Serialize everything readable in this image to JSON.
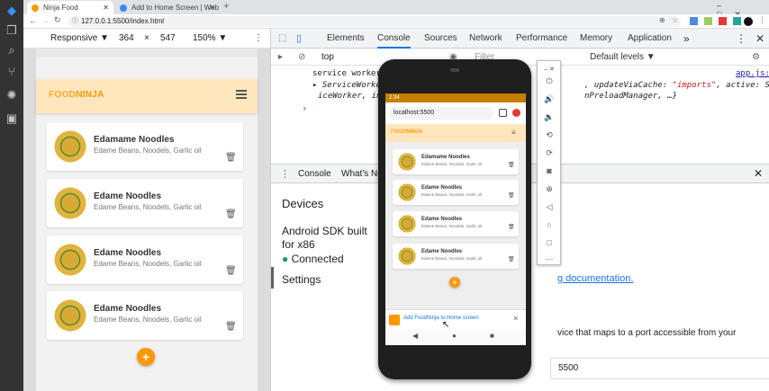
{
  "tabs": [
    {
      "title": "Ninja Food"
    },
    {
      "title": "Add to Home Screen | Web Fu..."
    }
  ],
  "new_tab_symbol": "+",
  "address": {
    "url": "127.0.0.1:5500/index.html"
  },
  "device_toolbar": {
    "device": "Responsive",
    "width": "364",
    "times": "×",
    "height": "547",
    "zoom": "150%"
  },
  "app": {
    "brand_left": "FOOD",
    "brand_right": "NINJA",
    "recipes": [
      {
        "title": "Edamame Noodles",
        "ingredients": "Edame Beans, Noodels, Garlic oil"
      },
      {
        "title": "Edame Noodles",
        "ingredients": "Edame Beans, Noodels, Garlic oil"
      },
      {
        "title": "Edame Noodles",
        "ingredients": "Edame Beans, Noodels, Garlic oil"
      },
      {
        "title": "Edame Noodles",
        "ingredients": "Edame Beans, Noodels, Garlic oil"
      }
    ],
    "add_symbol": "+",
    "trash_symbol": "🗑"
  },
  "devtools": {
    "tabs": [
      "Elements",
      "Console",
      "Sources",
      "Network",
      "Performance",
      "Memory",
      "Application"
    ],
    "more_tabs": "»",
    "context": "top",
    "filter_placeholder": "Filter",
    "levels": "Default levels ▼",
    "console_lines": [
      "service worker regis",
      "ServiceWorkerRegis",
      "iceWorker, installi"
    ],
    "console_right_1": "app.js:3",
    "console_right_2a": ", updateViaCache: ",
    "console_right_2b": "\"imports\"",
    "console_right_2c": ", active: Serv",
    "console_right_3": "nPreloadManager, …}",
    "prompt": "›",
    "drawer_tabs": [
      "Console",
      "What's Ne"
    ],
    "remote": {
      "heading": "Devices",
      "device_line1": "Android SDK built",
      "device_line2": "for x86",
      "status": "Connected",
      "settings": "Settings",
      "doc_link": "g documentation.",
      "port_text": "vice that maps to a port accessible from your",
      "port_value": "5500"
    }
  },
  "phone": {
    "status_time": "2:34",
    "url": "localhost:5500",
    "banner": "Add FoodNinja to Home screen",
    "banner_close": "×"
  },
  "colors": {
    "accent": "#ff9800",
    "nav_bg": "#ffe6bc",
    "link": "#1a73e8",
    "connected": "#0f9d58"
  }
}
